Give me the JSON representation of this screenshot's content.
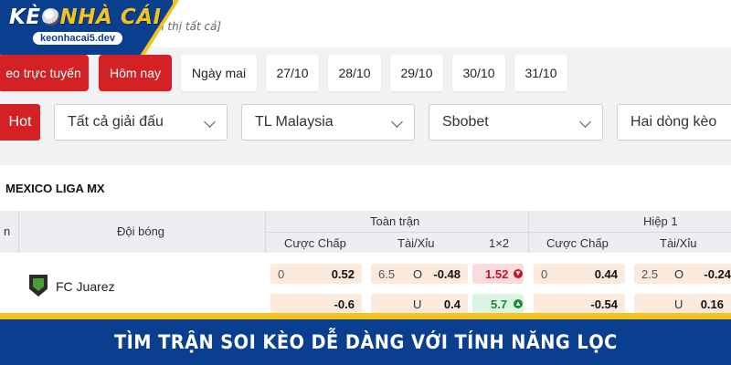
{
  "logo": {
    "brand_a": "KÈ",
    "brand_b": "NHÀ CÁI",
    "domain": "keonhacai5.dev"
  },
  "search": {
    "hint": "n thị tất cả]"
  },
  "date_tabs": [
    "eo trực tuyến",
    "Hôm nay",
    "Ngày mai",
    "27/10",
    "28/10",
    "29/10",
    "30/10",
    "31/10"
  ],
  "filters": {
    "hot": "Hot",
    "league": "Tất cả giải đấu",
    "tv": "TL Malaysia",
    "bookmaker": "Sbobet",
    "view": "Hai dòng kèo"
  },
  "table": {
    "league": "MEXICO LIGA MX",
    "col_n": "n",
    "col_team": "Đội bóng",
    "group_full": "Toàn trận",
    "group_half": "Hiệp 1",
    "sub_handicap": "Cược Chấp",
    "sub_ou": "Tài/Xỉu",
    "sub_1x2": "1×2",
    "sub_handicap_h1": "Cược Chấp",
    "sub_ou_h1": "Tài/Xỉu",
    "row1": {
      "team": "FC Juarez",
      "hc_line": "0",
      "hc_odds": "0.52",
      "ou_line": "6.5",
      "ou_side": "O",
      "ou_odds": "-0.48",
      "x12": "1.52",
      "h1_hc_line": "0",
      "h1_hc_odds": "0.44",
      "h1_ou_line": "2.5",
      "h1_ou_side": "O",
      "h1_ou_odds": "-0.24"
    },
    "row2": {
      "hc_odds": "-0.6",
      "ou_side": "U",
      "ou_odds": "0.4",
      "x12": "5.7",
      "h1_hc_odds": "-0.54",
      "h1_ou_side": "U",
      "h1_ou_odds": "0.16"
    }
  },
  "banner": {
    "text": "TÌM TRẬN SOI KÈO DỄ DÀNG VỚI TÍNH NĂNG LỌC"
  },
  "colors": {
    "brand_blue": "#0a3f8f",
    "accent_red": "#d42126",
    "gold": "#f3c21b"
  }
}
